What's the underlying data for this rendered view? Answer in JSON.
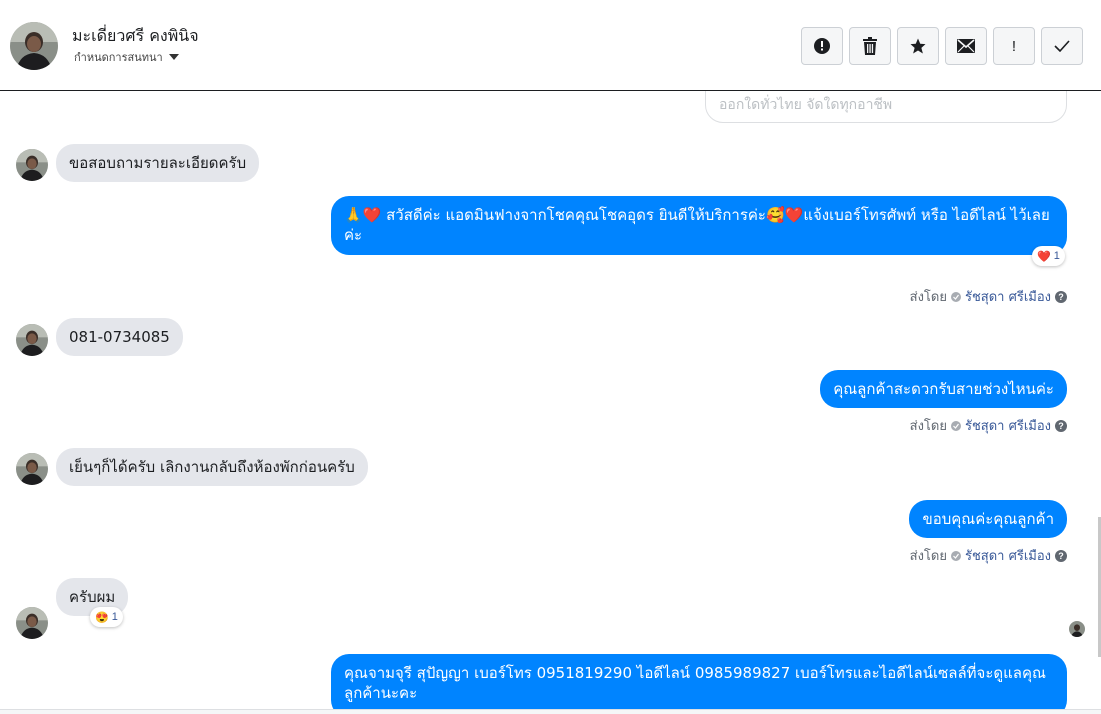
{
  "header": {
    "contact_name": "มะเดี่ยวศรี คงพินิจ",
    "assign_label": "กำหนดการสนทนา",
    "toolbar": {
      "spam": "!",
      "done": "✓"
    }
  },
  "chat": {
    "previous_text": "ออกใดทั่วไทย จัดใดทุกอาชีพ",
    "messages": [
      {
        "text": "ขอสอบถามรายละเอียดครับ"
      },
      {
        "text": "🙏❤️ สวัสดีค่ะ แอดมินฟางจากโชคคุณโชคอุดร ยินดีให้บริการค่ะ🥰❤️แจ้งเบอร์โทรศัพท์ หรือ ไอดีไลน์  ไว้เลยค่ะ"
      },
      {
        "text": "081-0734085"
      },
      {
        "text": "คุณลูกค้าสะดวกรับสายช่วงไหนค่ะ"
      },
      {
        "text": "เย็นๆก็ได้ครับ เลิกงานกลับถึงห้องพักก่อนครับ"
      },
      {
        "text": "ขอบคุณค่ะคุณลูกค้า"
      },
      {
        "text": "ครับผม"
      },
      {
        "text": "คุณจามจุรี สุปัญญา เบอร์โทร 0951819290  ไอดีไลน์ 0985989827  เบอร์โทรและไอดีไลน์เซลล์ที่จะดูแลคุณลูกค้านะคะ"
      }
    ],
    "sent_by_label": "ส่งโดย",
    "agent_name": "รัชสุดา ศรีเมือง",
    "help_glyph": "?",
    "reaction_count_1": "1",
    "reaction_count_2": "1",
    "reaction_emoji_1": "❤️",
    "reaction_emoji_2": "😍"
  }
}
